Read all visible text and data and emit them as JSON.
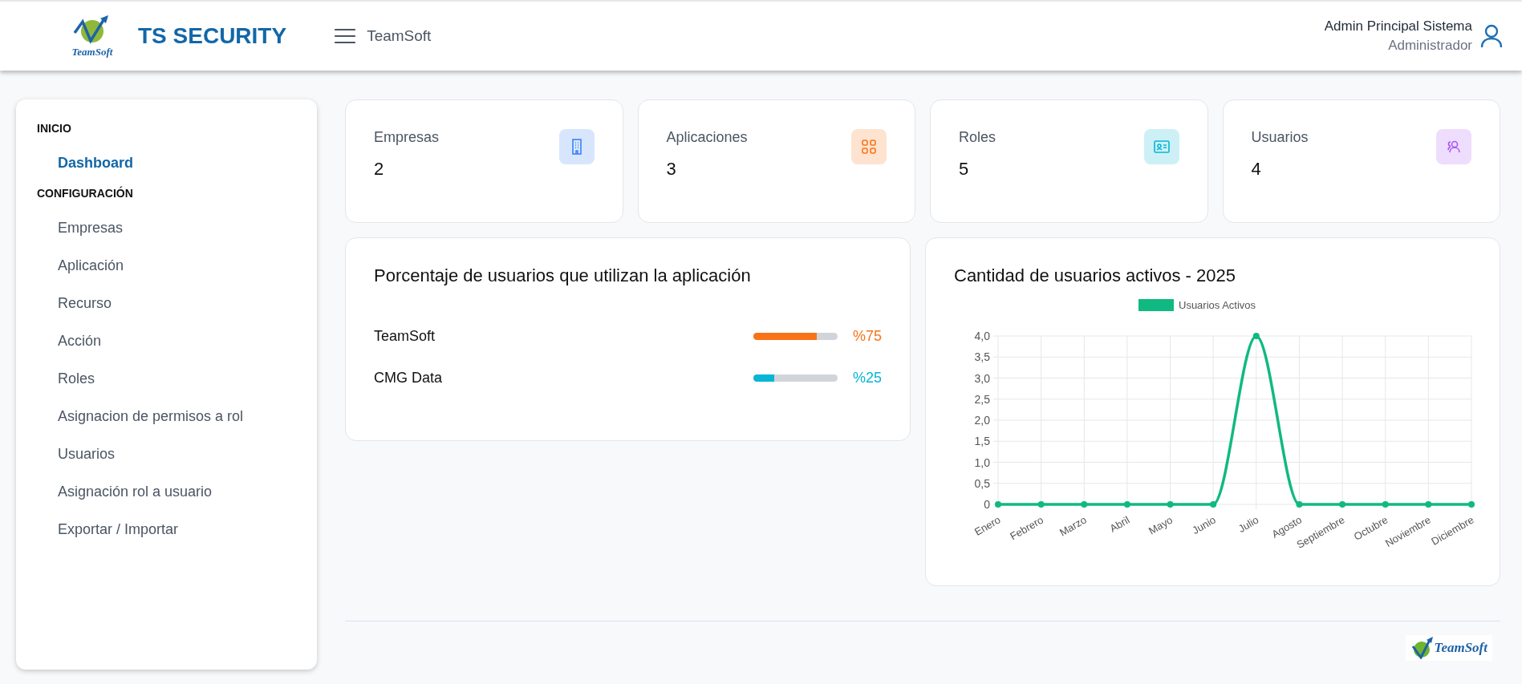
{
  "header": {
    "logo_text": "TeamSoft",
    "title": "TS SECURITY",
    "company": "TeamSoft",
    "user_name": "Admin Principal Sistema",
    "user_role": "Administrador"
  },
  "sidebar": {
    "sections": [
      {
        "title": "INICIO",
        "items": [
          {
            "label": "Dashboard",
            "selected": true
          }
        ]
      },
      {
        "title": "CONFIGURACIÓN",
        "items": [
          {
            "label": "Empresas",
            "selected": false
          },
          {
            "label": "Aplicación",
            "selected": false
          },
          {
            "label": "Recurso",
            "selected": false
          },
          {
            "label": "Acción",
            "selected": false
          },
          {
            "label": "Roles",
            "selected": false
          },
          {
            "label": "Asignacion de permisos a rol",
            "selected": false
          },
          {
            "label": "Usuarios",
            "selected": false
          },
          {
            "label": "Asignación rol a usuario",
            "selected": false
          },
          {
            "label": "Exportar / Importar",
            "selected": false
          }
        ]
      }
    ]
  },
  "stats": [
    {
      "label": "Empresas",
      "value": "2",
      "kind": "building",
      "color": "#3b82f6"
    },
    {
      "label": "Aplicaciones",
      "value": "3",
      "kind": "grid",
      "color": "#f97316"
    },
    {
      "label": "Roles",
      "value": "5",
      "kind": "idcard",
      "color": "#06b6d4"
    },
    {
      "label": "Usuarios",
      "value": "4",
      "kind": "users",
      "color": "#a855f7"
    }
  ],
  "usage": {
    "title": "Porcentaje de usuarios que utilizan la aplicación",
    "apps": [
      {
        "name": "TeamSoft",
        "level": 0.75,
        "reading": "%75",
        "color": "#f97316"
      },
      {
        "name": "CMG Data",
        "level": 0.25,
        "reading": "%25",
        "color": "#06b6d4"
      }
    ]
  },
  "activity": {
    "title": "Cantidad de usuarios activos - 2025",
    "chart_data": {
      "type": "line",
      "categories": [
        "Enero",
        "Febrero",
        "Marzo",
        "Abril",
        "Mayo",
        "Junio",
        "Julio",
        "Agosto",
        "Septiembre",
        "Octubre",
        "Noviembre",
        "Diciembre"
      ],
      "grid": true,
      "series": [
        {
          "name": "Usuarios Activos",
          "color": "#10b981",
          "marker": "circle",
          "values": [
            0,
            0,
            0,
            0,
            0,
            0,
            4,
            0,
            0,
            0,
            0,
            0
          ]
        }
      ],
      "ylim": [
        0,
        4
      ],
      "yticks": [
        {
          "value": 0,
          "label": "0"
        },
        {
          "value": 0.5,
          "label": "0,5"
        },
        {
          "value": 1,
          "label": "1,0"
        },
        {
          "value": 1.5,
          "label": "1,5"
        },
        {
          "value": 2,
          "label": "2,0"
        },
        {
          "value": 2.5,
          "label": "2,5"
        },
        {
          "value": 3,
          "label": "3,0"
        },
        {
          "value": 3.5,
          "label": "3,5"
        },
        {
          "value": 4,
          "label": "4,0"
        }
      ]
    }
  },
  "footer": {
    "logo_text": "TeamSoft"
  }
}
